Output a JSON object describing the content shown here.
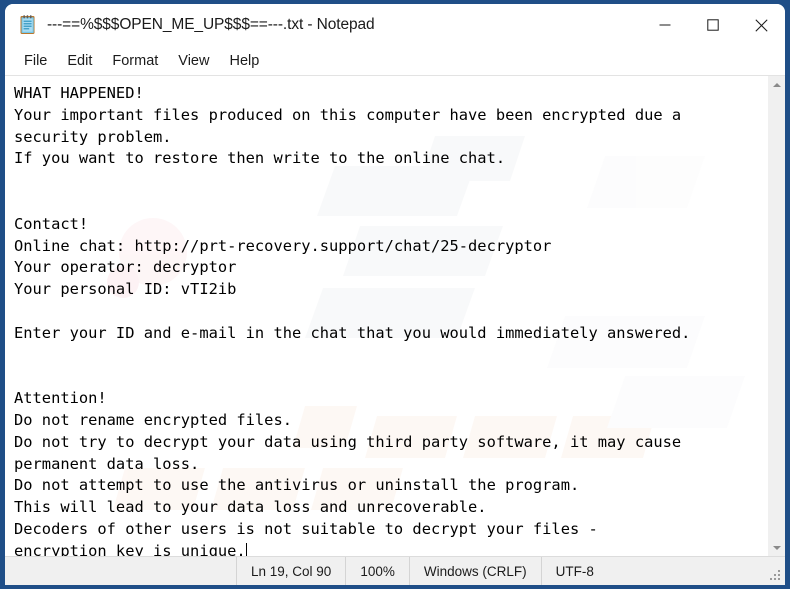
{
  "window": {
    "title": "---==%$$$OPEN_ME_UP$$$==---.txt - Notepad",
    "app_icon": "notepad-icon",
    "frame_color": "#1f4e87",
    "background_color": "#ffffff",
    "controls": {
      "minimize_label": "–",
      "maximize_label": "❑",
      "close_label": "✕",
      "minimize_name": "minimize-button",
      "maximize_name": "maximize-button",
      "close_name": "close-button"
    }
  },
  "menu": {
    "items": [
      {
        "label": "File"
      },
      {
        "label": "Edit"
      },
      {
        "label": "Format"
      },
      {
        "label": "View"
      },
      {
        "label": "Help"
      }
    ]
  },
  "editor": {
    "text": "WHAT HAPPENED!\nYour important files produced on this computer have been encrypted due a\nsecurity problem.\nIf you want to restore then write to the online chat.\n\n\nContact!\nOnline chat: http://prt-recovery.support/chat/25-decryptor\nYour operator: decryptor\nYour personal ID: vTI2ib\n\nEnter your ID and e-mail in the chat that you would immediately answered.\n\n\nAttention!\nDo not rename encrypted files.\nDo not try to decrypt your data using third party software, it may cause\npermanent data loss.\nDo not attempt to use the antivirus or uninstall the program.\nThis will lead to your data loss and unrecoverable.\nDecoders of other users is not suitable to decrypt your files -\nencryption key is unique.",
    "lines": [
      "WHAT HAPPENED!",
      "Your important files produced on this computer have been encrypted due a",
      "security problem.",
      "If you want to restore then write to the online chat.",
      "",
      "",
      "Contact!",
      "Online chat: http://prt-recovery.support/chat/25-decryptor",
      "Your operator: decryptor",
      "Your personal ID: vTI2ib",
      "",
      "Enter your ID and e-mail in the chat that you would immediately answered.",
      "",
      "",
      "Attention!",
      "Do not rename encrypted files.",
      "Do not try to decrypt your data using third party software, it may cause",
      "permanent data loss.",
      "Do not attempt to use the antivirus or uninstall the program.",
      "This will lead to your data loss and unrecoverable.",
      "Decoders of other users is not suitable to decrypt your files -",
      "encryption key is unique."
    ],
    "ransom_details": {
      "online_chat_url": "http://prt-recovery.support/chat/25-decryptor",
      "operator": "decryptor",
      "personal_id": "vTI2ib"
    }
  },
  "scrollbar": {
    "up_arrow": "scroll-up-arrow",
    "down_arrow": "scroll-down-arrow"
  },
  "status_bar": {
    "cursor_position": "Ln 19, Col 90",
    "zoom": "100%",
    "line_ending": "Windows (CRLF)",
    "encoding": "UTF-8"
  }
}
